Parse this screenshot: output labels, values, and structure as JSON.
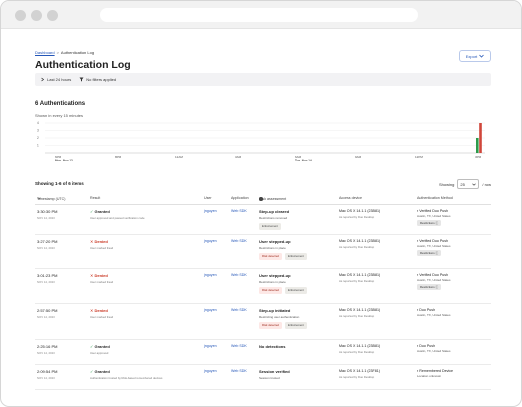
{
  "breadcrumb": {
    "root": "Dashboard",
    "separator": ">",
    "current": "Authentication Log"
  },
  "page": {
    "title": "Authentication Log",
    "export_label": "Export"
  },
  "filters": {
    "range": "Last 24 hours",
    "applied": "No filters applied"
  },
  "summary": {
    "count_label": "6 Authentications",
    "interval_label": "Shown in every 15 minutes"
  },
  "chart_data": {
    "type": "bar",
    "x_ticks": [
      "6PM\nMon, Nov 13",
      "8PM",
      "12AM",
      "3AM",
      "6AM\nTue, Nov 14",
      "9AM",
      "12PM",
      "3PM"
    ],
    "y_ticks": [
      "4",
      "3",
      "2",
      "1"
    ],
    "series": [
      {
        "color": "#2c9b4b",
        "values": [
          2
        ]
      },
      {
        "color": "#d0463a",
        "values": [
          4
        ]
      }
    ],
    "ylim": [
      0,
      4
    ],
    "grid": true
  },
  "table": {
    "showing": "Showing 1-6 of 6 items",
    "page_size_label": "Showing",
    "page_size": "25",
    "per_page_suffix": "/ row",
    "columns": [
      "Timestamp (UTC)",
      "Result",
      "User",
      "Application",
      "Risk assessment",
      "Access device",
      "Authentication Method"
    ],
    "rows": [
      {
        "time": "3:30:30 PM",
        "date": "NOV 14, 2023",
        "result": "Granted",
        "result_type": "granted",
        "result_sub": "User approved and passed verification code",
        "user": "jnguyen",
        "app": "Web SDK",
        "risk_title": "Step-up cleared",
        "risk_sub": "Restrictions removed",
        "tags": [
          {
            "label": "Enforcement",
            "kind": "enf"
          }
        ],
        "device": "Mac OS X 14.1.1 (23B81)",
        "device_sub": "As reported by Duo Desktop",
        "method": "Verified Duo Push",
        "method_sub": "Austin, TX, United States",
        "chip": "Restrictions"
      },
      {
        "time": "3:27:20 PM",
        "date": "NOV 14, 2023",
        "result": "Denied",
        "result_type": "denied",
        "result_sub": "User marked fraud",
        "user": "jnguyen",
        "app": "Web SDK",
        "risk_title": "User stepped-up",
        "risk_sub": "Restrictions in place",
        "tags": [
          {
            "label": "Risk detected",
            "kind": "risk"
          },
          {
            "label": "Enforcement",
            "kind": "enf"
          }
        ],
        "device": "Mac OS X 14.1.1 (23B81)",
        "device_sub": "As reported by Duo Desktop",
        "method": "Verified Duo Push",
        "method_sub": "Austin, TX, United States",
        "chip": "Restrictions"
      },
      {
        "time": "3:01:23 PM",
        "date": "NOV 14, 2023",
        "result": "Denied",
        "result_type": "denied",
        "result_sub": "User marked fraud",
        "user": "jnguyen",
        "app": "Web SDK",
        "risk_title": "User stepped-up",
        "risk_sub": "Restrictions in place",
        "tags": [
          {
            "label": "Risk detected",
            "kind": "risk"
          },
          {
            "label": "Enforcement",
            "kind": "enf"
          }
        ],
        "device": "Mac OS X 14.1.1 (23B81)",
        "device_sub": "As reported by Duo Desktop",
        "method": "Verified Duo Push",
        "method_sub": "Austin, TX, United States",
        "chip": "Restrictions"
      },
      {
        "time": "2:57:50 PM",
        "date": "NOV 14, 2023",
        "result": "Denied",
        "result_type": "denied",
        "result_sub": "User marked fraud",
        "user": "jnguyen",
        "app": "Web SDK",
        "risk_title": "Step-up initiated",
        "risk_sub": "Restricting user authentication",
        "tags": [
          {
            "label": "Risk detected",
            "kind": "risk"
          },
          {
            "label": "Enforcement",
            "kind": "enf"
          }
        ],
        "device": "Mac OS X 14.1.1 (23B81)",
        "device_sub": "As reported by Duo Desktop",
        "method": "Duo Push",
        "method_sub": "Austin, TX, United States",
        "chip": ""
      },
      {
        "time": "2:25:16 PM",
        "date": "NOV 14, 2023",
        "result": "Granted",
        "result_type": "granted",
        "result_sub": "User approved",
        "user": "jnguyen",
        "app": "Web SDK",
        "risk_title": "No detections",
        "risk_sub": "",
        "tags": [],
        "device": "Mac OS X 14.1.1 (23B81)",
        "device_sub": "As reported by Duo Desktop",
        "method": "Duo Push",
        "method_sub": "Austin, TX, United States",
        "chip": ""
      },
      {
        "time": "2:09:54 PM",
        "date": "NOV 14, 2023",
        "result": "Granted",
        "result_type": "granted",
        "result_sub": "Authentication trusted by Risk-based remembered devices",
        "user": "jnguyen",
        "app": "Web SDK",
        "risk_title": "Session verified",
        "risk_sub": "Session trusted",
        "tags": [],
        "device": "Mac OS X 14.1.1 (23F81)",
        "device_sub": "As reported by Duo Desktop",
        "method": "Remembered Device",
        "method_sub": "Location unknown",
        "chip": ""
      }
    ]
  }
}
